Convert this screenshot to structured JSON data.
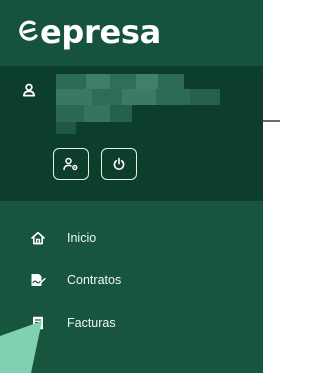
{
  "brand": {
    "name": "epresa",
    "logo_icon": "e-swoosh-logo-icon"
  },
  "user_panel": {
    "user_icon": "user-icon",
    "name_redacted": true,
    "profile_button_icon": "user-settings-icon",
    "logout_button_icon": "power-icon"
  },
  "nav": {
    "items": [
      {
        "label": "Inicio",
        "icon": "home-icon"
      },
      {
        "label": "Contratos",
        "icon": "contract-sign-icon"
      },
      {
        "label": "Facturas",
        "icon": "invoice-icon"
      }
    ]
  },
  "colors": {
    "sidebar_bg": "#17553f",
    "brand_bg": "#15533d",
    "user_panel_bg": "#0d3e2c",
    "text": "#ffffff",
    "pointer": "#7fd1b0"
  }
}
